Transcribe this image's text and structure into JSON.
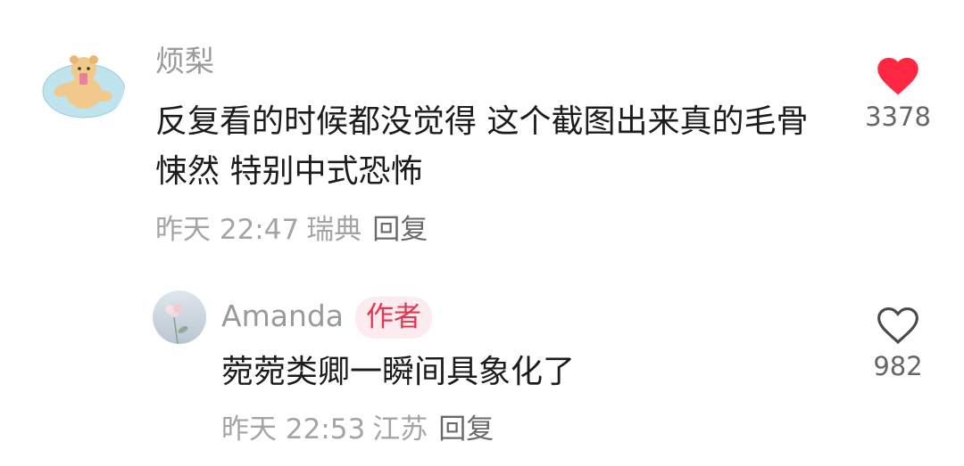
{
  "comments": [
    {
      "username": "烦梨",
      "text": "反复看的时候都没觉得 这个截图出来真的毛骨悚然 特别中式恐怖",
      "time": "昨天 22:47",
      "location": "瑞典",
      "reply_label": "回复",
      "like_count": "3378",
      "liked": true,
      "like_color": "#ff2742"
    },
    {
      "username": "Amanda",
      "badge": "作者",
      "text": "菀菀类卿一瞬间具象化了",
      "time": "昨天 22:53",
      "location": "江苏",
      "reply_label": "回复",
      "like_count": "982",
      "liked": false
    }
  ]
}
